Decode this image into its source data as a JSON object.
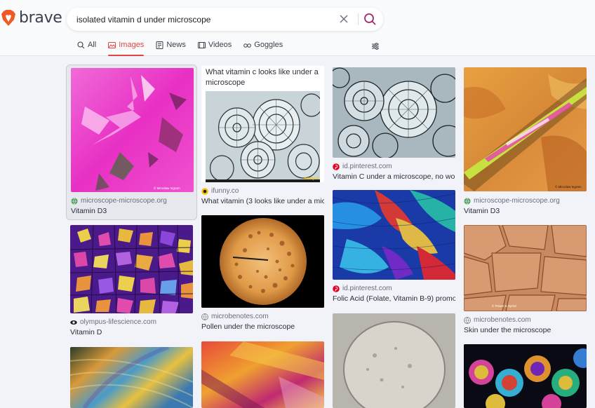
{
  "app": {
    "brand": "brave",
    "colors": {
      "accent": "#e2443f",
      "search_accent": "#a0286f",
      "background": "#f1f3f9"
    }
  },
  "search": {
    "query": "isolated vitamin d under microscope",
    "clear_icon": "close-icon",
    "submit_icon": "search-icon"
  },
  "tabs": [
    {
      "label": "All",
      "icon": "search-icon",
      "active": false
    },
    {
      "label": "Images",
      "icon": "image-icon",
      "active": true
    },
    {
      "label": "News",
      "icon": "newspaper-icon",
      "active": false
    },
    {
      "label": "Videos",
      "icon": "video-icon",
      "active": false
    },
    {
      "label": "Goggles",
      "icon": "goggles-icon",
      "active": false
    }
  ],
  "filter_icon": "sliders-icon",
  "results": [
    {
      "source": "microscope-microscope.org",
      "title": "Vitamin D3",
      "favicon": "globe-icon"
    },
    {
      "heading": "What vitamin c looks like under a microscope",
      "source": "ifunny.co",
      "title": "What vitamin (3 looks like under a mic...",
      "watermark": "ifunny.co",
      "favicon": "ifunny-icon"
    },
    {
      "source": "id.pinterest.com",
      "title": "Vitamin C under a microscope, no wo...",
      "favicon": "pinterest-icon"
    },
    {
      "source": "microscope-microscope.org",
      "title": "Vitamin D3",
      "watermark": "© Miroslaw Ingram",
      "favicon": "globe-icon"
    },
    {
      "source": "olympus-lifescience.com",
      "title": "Vitamin D",
      "favicon": "eye-icon"
    },
    {
      "source": "microbenotes.com",
      "title": "Pollen under the microscope",
      "favicon": "globe-icon"
    },
    {
      "source": "id.pinterest.com",
      "title": "Folic Acid (Folate, Vitamin B-9) promo...",
      "favicon": "pinterest-icon"
    },
    {
      "source": "microbenotes.com",
      "title": "Skin under the microscope",
      "watermark": "© Power & Syred",
      "favicon": "globe-icon"
    }
  ],
  "first_card_watermark": "© Miroslaw Ingram"
}
